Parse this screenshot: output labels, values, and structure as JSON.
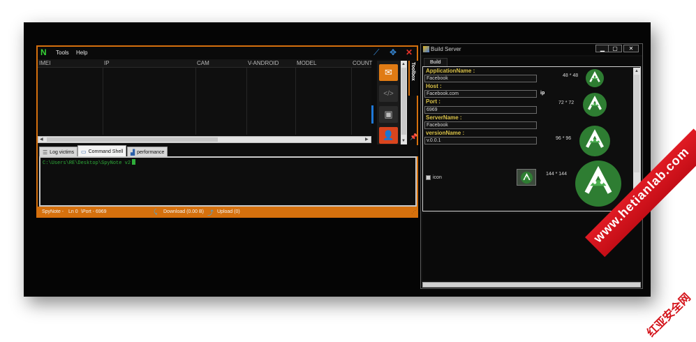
{
  "main_window": {
    "menu": [
      "Tools",
      "Help"
    ],
    "columns": [
      "IMEI",
      "IP",
      "CAM",
      "V-ANDROID",
      "MODEL",
      "COUNT"
    ],
    "toolbox_label": "Toolbox",
    "tabs": [
      {
        "label": "Log victims"
      },
      {
        "label": "Command Shell"
      },
      {
        "label": "performance"
      }
    ],
    "shell_prompt": "C:\\Users\\RE\\Desktop\\SpyNote v2",
    "status": {
      "app": "SpyNote -",
      "line": "Ln 0",
      "port": "\\Port - 6969",
      "download": "Download (0.00 B)",
      "upload": "Upload  (0)"
    },
    "colors": {
      "accent": "#d5700d",
      "shell_text": "#2fae3a",
      "mail_button": "#e07b14",
      "contact_button": "#d9451e"
    }
  },
  "build_window": {
    "title": "Build Server",
    "tab": "Build",
    "fields": [
      {
        "label": "ApplicationName :",
        "value": "Facebook"
      },
      {
        "label": "Host :",
        "value": "Facebook.com"
      },
      {
        "label": "Port :",
        "value": "6969"
      },
      {
        "label": "ServerName :",
        "value": "Facebook"
      },
      {
        "label": "versionName :",
        "value": "v.0.0.1"
      }
    ],
    "ip_label": "ip",
    "icon_sizes": [
      "48 * 48",
      "72 * 72",
      "96 * 96",
      "144 * 144"
    ],
    "icon_checkbox": "icon",
    "colors": {
      "field_label": "#d9c147",
      "android_green": "#2e7d32"
    }
  },
  "watermark": {
    "url": "www.hetianlab.com",
    "brand": "红亚安全网"
  }
}
